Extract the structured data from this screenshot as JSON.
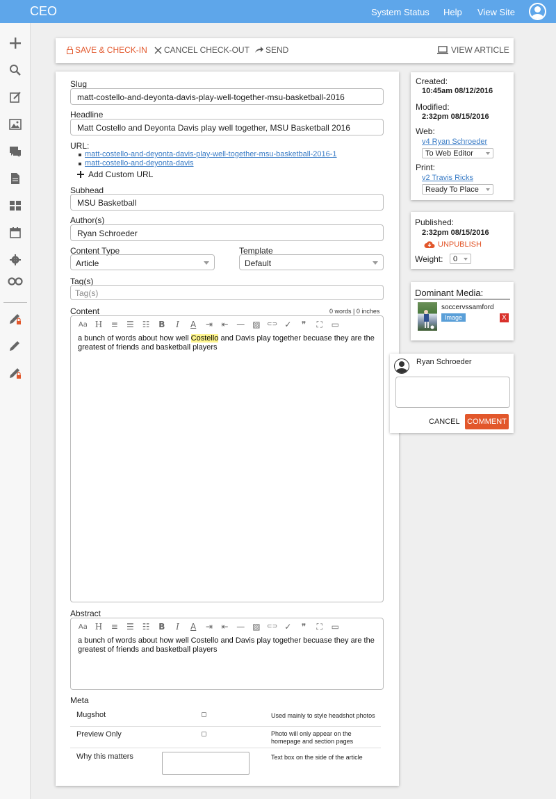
{
  "app": {
    "title": "CEO"
  },
  "topnav": {
    "system_status": "System Status",
    "help": "Help",
    "view_site": "View Site"
  },
  "sidebar": {
    "icons": [
      "plus-icon",
      "search-icon",
      "edit-note-icon",
      "image-icon",
      "comments-icon",
      "document-icon",
      "dashboard-icon",
      "calendar-icon",
      "settings-icon",
      "infinity-icon",
      "pencil-locked-icon",
      "pencil-icon",
      "pencil-locked-icon"
    ]
  },
  "toolbar": {
    "save_checkin": "SAVE & CHECK-IN",
    "cancel_checkout": "CANCEL CHECK-OUT",
    "send": "SEND",
    "view_article": "VIEW ARTICLE",
    "accent_color": "#e2572b"
  },
  "form": {
    "slug_label": "Slug",
    "slug_value": "matt-costello-and-deyonta-davis-play-well-together-msu-basketball-2016",
    "headline_label": "Headline",
    "headline_value": "Matt Costello and Deyonta Davis play well together, MSU Basketball 2016",
    "url_label": "URL:",
    "urls": [
      "matt-costello-and-deyonta-davis-play-well-together-msu-basketball-2016-1",
      "matt-costello-and-deyonta-davis"
    ],
    "add_custom_url": "Add Custom URL",
    "subhead_label": "Subhead",
    "subhead_value": "MSU Basketball",
    "authors_label": "Author(s)",
    "authors_value": "Ryan Schroeder",
    "content_type_label": "Content Type",
    "content_type_value": "Article",
    "template_label": "Template",
    "template_value": "Default",
    "tags_label": "Tag(s)",
    "tags_placeholder": "Tag(s)",
    "content_label": "Content",
    "content_stats": "0 words | 0 inches",
    "content_before": "a bunch of words about how well ",
    "content_highlight": "Costello",
    "content_after": " and Davis play together becuase they are the greatest of friends and basketball players",
    "abstract_label": "Abstract",
    "abstract_text": "a bunch of words about how well Costello and Davis play together becuase they are the greatest of friends and basketball players",
    "editor_tools": [
      "font-size-icon",
      "heading-icon",
      "align-left-icon",
      "bullet-list-icon",
      "numbered-list-icon",
      "bold-icon",
      "italic-icon",
      "text-color-icon",
      "indent-icon",
      "outdent-icon",
      "horizontal-rule-icon",
      "insert-image-icon",
      "link-icon",
      "check-icon",
      "quote-icon",
      "fullscreen-icon",
      "comment-icon"
    ],
    "editor_tool_glyphs": [
      "Aa",
      "H",
      "≡",
      "☰",
      "☷",
      "B",
      "I",
      "A",
      "⇥",
      "⇤",
      "—",
      "▨",
      "⊂⊃",
      "✓",
      "❞",
      "⛶",
      "▭"
    ]
  },
  "meta": {
    "label": "Meta",
    "rows": [
      {
        "name": "Mugshot",
        "desc": "Used mainly to style headshot photos"
      },
      {
        "name": "Preview Only",
        "desc": "Photo will only appear on the homepage and section pages"
      },
      {
        "name": "Why this matters",
        "desc": "Text box on the side of the article"
      }
    ]
  },
  "status_card": {
    "created_label": "Created:",
    "created_value": "10:45am 08/12/2016",
    "modified_label": "Modified:",
    "modified_value": "2:32pm 08/15/2016",
    "web_label": "Web:",
    "web_link": "v4 Ryan Schroeder",
    "web_status": "To Web Editor",
    "print_label": "Print:",
    "print_link": "v2 Travis Ricks",
    "print_status": "Ready To Place"
  },
  "publish_card": {
    "published_label": "Published:",
    "published_value": "2:32pm 08/15/2016",
    "unpublish": "UNPUBLISH",
    "weight_label": "Weight:",
    "weight_value": "0"
  },
  "media_card": {
    "title": "Dominant Media:",
    "item_name": "soccervssamford",
    "item_badge": "Image",
    "remove": "X"
  },
  "comment_card": {
    "user": "Ryan Schroeder",
    "cancel": "CANCEL",
    "comment": "COMMENT"
  }
}
